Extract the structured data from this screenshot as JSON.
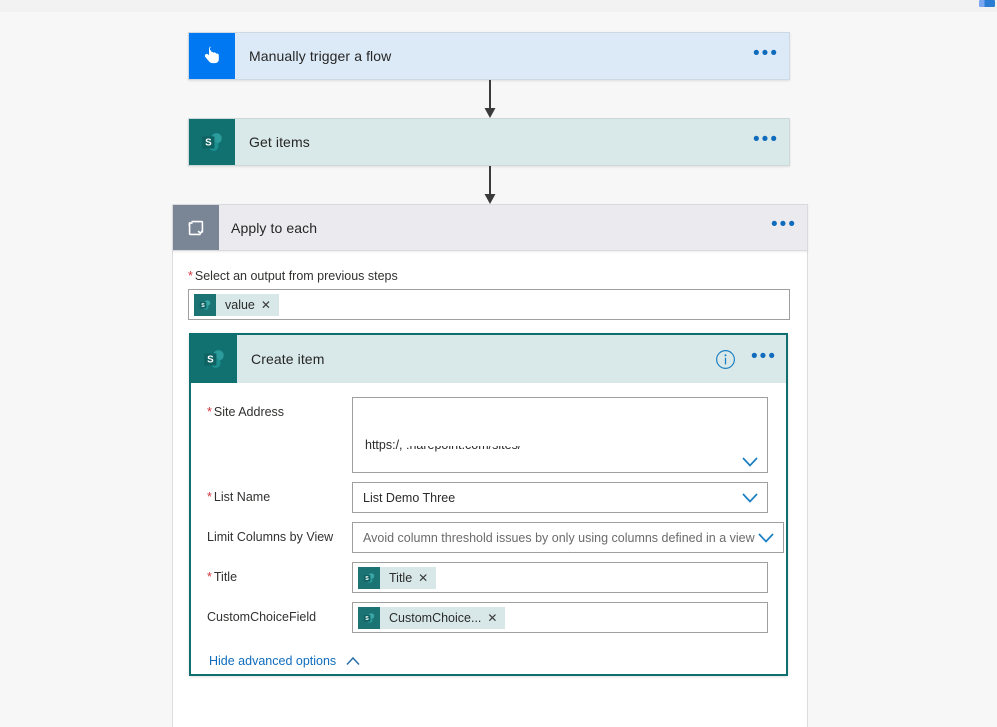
{
  "app": {
    "surface": "power-automate-flow-designer-canvas"
  },
  "trigger": {
    "title": "Manually trigger a flow",
    "icon": "manual-trigger-tap-icon",
    "menu_label": "•••",
    "accent": "#0078f2",
    "background": "#dceaf7"
  },
  "get_items": {
    "title": "Get items",
    "icon": "sharepoint-icon",
    "menu_label": "•••",
    "accent": "#117070",
    "background": "#d9e8e8"
  },
  "apply_to_each": {
    "title": "Apply to each",
    "icon": "loop-repeat-icon",
    "menu_label": "•••",
    "accent": "#7a8596",
    "background": "#eaeaef",
    "field": {
      "label": "Select an output from previous steps",
      "required": true,
      "required_marker": "*",
      "token": {
        "text": "value",
        "icon": "sharepoint-icon",
        "remove_label": "✕"
      }
    }
  },
  "create_item": {
    "title": "Create item",
    "icon": "sharepoint-icon",
    "info_label": "i",
    "menu_label": "•••",
    "border_color": "#0f6e6e",
    "header_background": "#d9e8e8",
    "fields": [
      {
        "label": "Site Address",
        "required_marker": "*",
        "type": "combo-multiline",
        "line1": ": -",
        "line2": "https:/,                      :harepoint.com/sites/",
        "chevron": "chevron-down-icon"
      },
      {
        "label": "List Name",
        "required_marker": "*",
        "type": "combo",
        "value": "List Demo Three",
        "chevron": "chevron-down-icon"
      },
      {
        "label": "Limit Columns by View",
        "required_marker": "",
        "type": "combo",
        "value": "Avoid column threshold issues by only using columns defined in a view",
        "is_placeholder": true,
        "chevron": "chevron-down-icon"
      },
      {
        "label": "Title",
        "required_marker": "*",
        "type": "token",
        "token_text": "Title",
        "token_icon": "sharepoint-icon",
        "remove_label": "✕"
      },
      {
        "label": "CustomChoiceField",
        "required_marker": "",
        "type": "token",
        "token_text": "CustomChoice...",
        "token_icon": "sharepoint-icon",
        "remove_label": "✕"
      }
    ],
    "advanced_link": "Hide advanced options",
    "advanced_chevron": "chevron-up-icon"
  }
}
